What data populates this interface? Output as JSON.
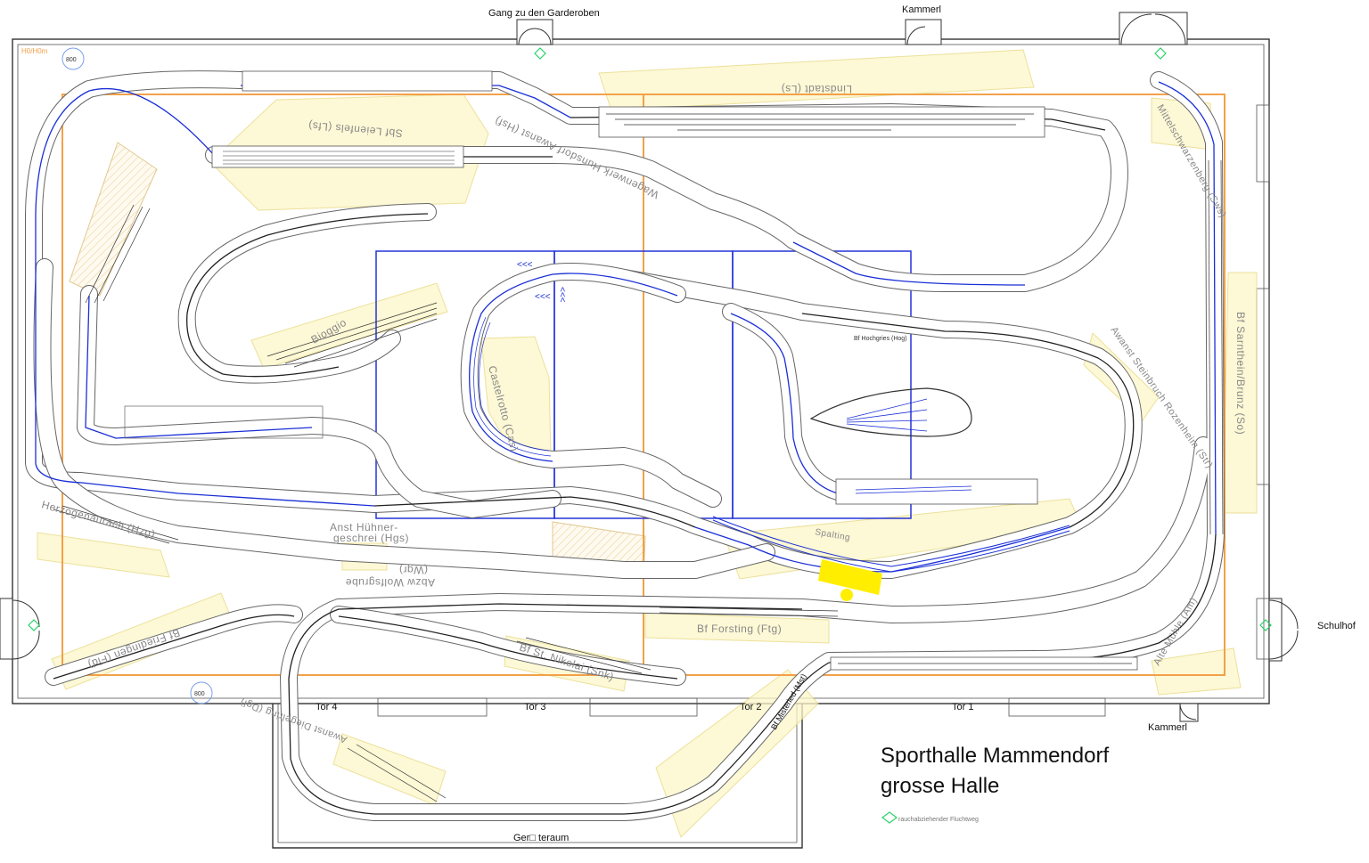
{
  "title_line1": "Sporthalle Mammendorf",
  "title_line2": "grosse Halle",
  "room_labels": {
    "corridor": "Gang zu den Garderoben",
    "kammerl_top": "Kammerl",
    "kammerl_bottom": "Kammerl",
    "schulhof": "Schulhof",
    "geraeteraum": "Ger□ teraum",
    "tor1": "Tor 1",
    "tor2": "Tor 2",
    "tor3": "Tor 3",
    "tor4": "Tor 4"
  },
  "station_labels": {
    "lindstadt": "Lindstadt (Ls)",
    "leienfels": "Sbf Leienfels (Lfs)",
    "hunsdorf": "Wagenwerk Hunsdorf Awanst (Hsf)",
    "mittelschwarzen": "Mittelschwarzenberg (Sws)",
    "sarnthein": "Bf Sarnthein/Brunz (So)",
    "steinbruch": "Awanst Steinbruch Rozenheim (Str)",
    "bioggio": "Bioggio",
    "castelrotto": "Castelrotto (Cas)",
    "hochgries": "Bf Hochgries (Hog)",
    "spalting": "Spalting",
    "huehnergeschrei_1": "Anst Hühner-",
    "huehnergeschrei_2": "geschrei (Hgs)",
    "herzogenaurach": "Herzogenaurach (Hzg)",
    "wolfsgrube_1": "Abzw Wolfsgrube",
    "wolfsgrube_2": "(Wgr)",
    "forsting": "Bf Forsting (Ftg)",
    "stnikolai": "Bf St. Nikolai (Snk)",
    "friedingen": "Bf Friedingen (Fid)",
    "muehle": "Alte Mühle (Am)",
    "misteried": "Bf Misteried (Mst)",
    "diegelring": "Awanst Diegelring (Dgl)"
  },
  "markers": {
    "h0m": "H0/H0m",
    "circle_top": "800",
    "circle_bottom": "800"
  },
  "legend_text": "rauchabziehender Fluchtweg",
  "colors": {
    "track_blue": "#1a2fd6",
    "frame_orange": "#f2a14a",
    "highlight_yellow": "#ffee00",
    "zone_yellow": "#fdf6c8",
    "escape_green": "#2bd16a"
  }
}
